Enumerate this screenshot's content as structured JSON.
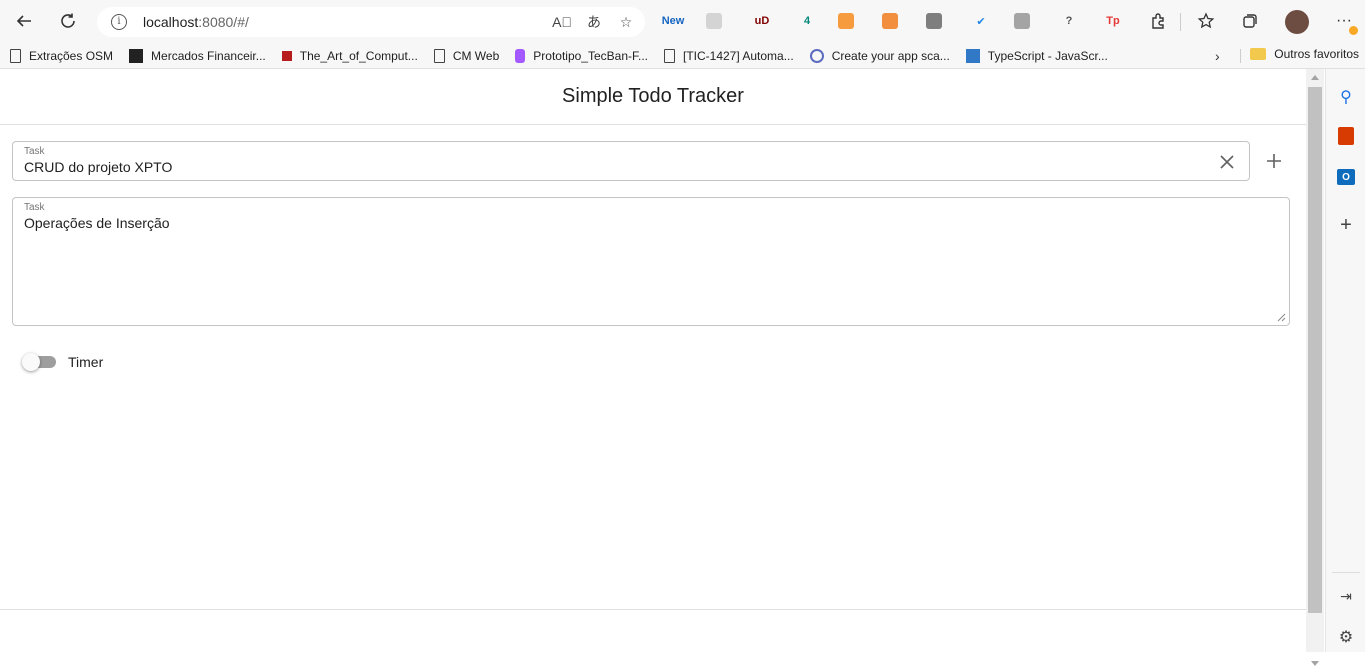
{
  "browser": {
    "url_host": "localhost",
    "url_rest": ":8080/#/",
    "extensions": [
      {
        "name": "new-extension-icon",
        "text": "New",
        "color": "#1565c0"
      },
      {
        "name": "react-devtools-icon",
        "text": "",
        "color": "#c8c8c8"
      },
      {
        "name": "ublock-icon",
        "text": "uD",
        "color": "#800000"
      },
      {
        "name": "counter-extension-icon",
        "text": "4",
        "color": "#00897b"
      },
      {
        "name": "lighthouse-icon",
        "text": "",
        "color": "#f57c00"
      },
      {
        "name": "firefox-relay-icon",
        "text": "",
        "color": "#ef6c00"
      },
      {
        "name": "screen-capture-icon",
        "text": "",
        "color": "#555555"
      },
      {
        "name": "check-extension-icon",
        "text": "✔",
        "color": "#1e88e5"
      },
      {
        "name": "copy-extension-icon",
        "text": "",
        "color": "#888888"
      },
      {
        "name": "help-extension-icon",
        "text": "?",
        "color": "#555555"
      },
      {
        "name": "tp-extension-icon",
        "text": "Tp",
        "color": "#e53935"
      }
    ]
  },
  "bookmarks": [
    {
      "label": "Extrações OSM",
      "icon": "page-icon"
    },
    {
      "label": "Mercados Financeir...",
      "icon": "inv-icon"
    },
    {
      "label": "The_Art_of_Comput...",
      "icon": "book-icon"
    },
    {
      "label": "CM Web",
      "icon": "page-icon"
    },
    {
      "label": "Prototipo_TecBan-F...",
      "icon": "figma-icon"
    },
    {
      "label": "[TIC-1427] Automa...",
      "icon": "page-icon"
    },
    {
      "label": "Create your app sca...",
      "icon": "app-icon"
    },
    {
      "label": "TypeScript - JavaScr...",
      "icon": "ts-icon"
    }
  ],
  "bookmarks_other": "Outros favoritos",
  "app": {
    "title": "Simple Todo Tracker",
    "task_label": "Task",
    "task_value": "CRUD do projeto XPTO",
    "description_label": "Task",
    "description_value": "Operações de Inserção",
    "timer_label": "Timer",
    "timer_on": false
  },
  "colors": {
    "accent": "#1976d2",
    "switch_track_off": "#9e9e9e"
  }
}
